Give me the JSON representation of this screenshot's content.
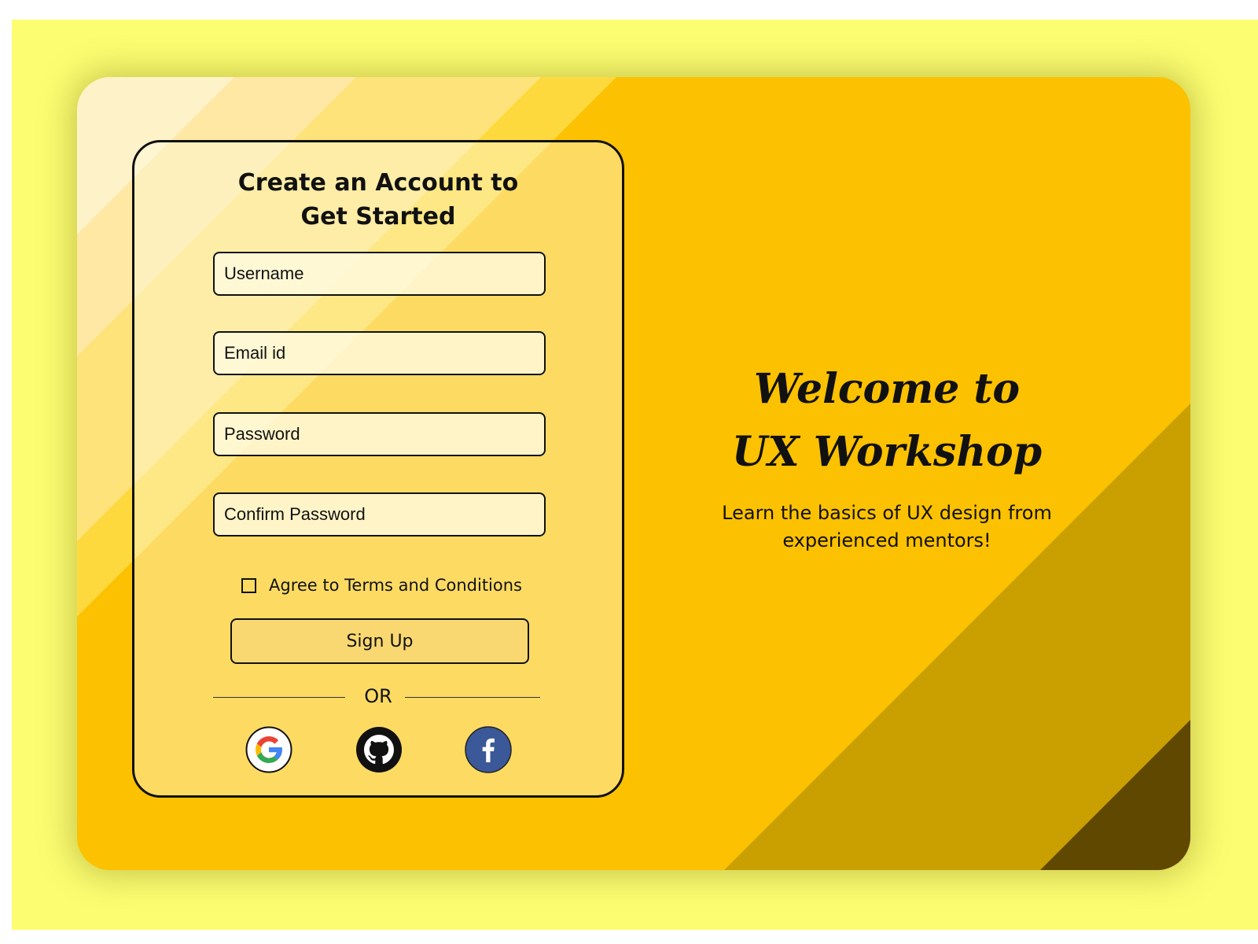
{
  "form": {
    "title_line1": "Create an Account to",
    "title_line2": "Get Started",
    "fields": [
      {
        "name": "username",
        "placeholder": "Username",
        "value": ""
      },
      {
        "name": "email",
        "placeholder": "Email id",
        "value": ""
      },
      {
        "name": "password",
        "placeholder": "Password",
        "value": ""
      },
      {
        "name": "confirm_password",
        "placeholder": "Confirm Password",
        "value": ""
      }
    ],
    "terms_label": "Agree to Terms and Conditions",
    "terms_checked": false,
    "signup_label": "Sign Up",
    "divider_text": "OR",
    "social": [
      {
        "name": "google",
        "icon": "google-icon"
      },
      {
        "name": "github",
        "icon": "github-icon"
      },
      {
        "name": "facebook",
        "icon": "facebook-icon",
        "color": "#3b5998"
      }
    ]
  },
  "hero": {
    "welcome_line1": "Welcome to",
    "welcome_line2": "UX Workshop",
    "subtitle_line1": "Learn the basics of UX design from",
    "subtitle_line2": "experienced mentors!"
  },
  "colors": {
    "page_background": "#fdfd72",
    "stripe_1": "#fef2c8",
    "stripe_2": "#fee8a3",
    "stripe_3": "#fee27a",
    "stripe_4": "#fed93e",
    "stripe_5": "#fcc100",
    "stripe_6": "#c9a000",
    "stripe_7": "#604800",
    "signup_button": "#fad871"
  }
}
